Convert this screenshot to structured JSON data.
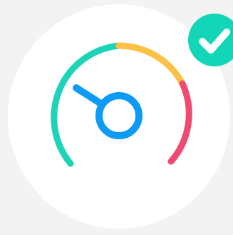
{
  "illustration": {
    "meaning": "speed-gauge-with-check",
    "gauge": {
      "segments": [
        {
          "name": "low",
          "color": "#1dd3b8"
        },
        {
          "name": "medium",
          "color": "#fcc145"
        },
        {
          "name": "high",
          "color": "#ef4a72"
        }
      ],
      "needle_color": "#0e9bf5"
    },
    "badge": {
      "icon": "check-icon",
      "color": "#13d6b8",
      "state": "success"
    },
    "background_color": "#ffffff"
  }
}
